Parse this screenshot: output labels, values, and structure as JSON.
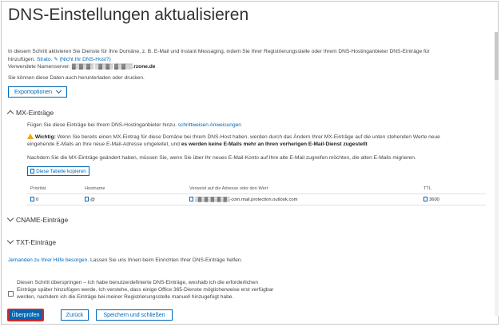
{
  "page": {
    "title": "DNS-Einstellungen aktualisieren"
  },
  "intro": {
    "line1": "In diesem Schritt aktivieren Sie Dienste für Ihre Domäne, z. B. E-Mail und Instant Messaging, indem Sie Ihrer Registrierungsstelle oder Ihrem DNS-Hostinganbieter DNS-Einträge für",
    "line1_tail": "hinzufügen.",
    "line2_prefix": "hinzufügen.",
    "provider": "Strato.",
    "not_host_link": "(Nicht Ihr DNS-Host?)",
    "nameserver_label": "Verwendete Namenserver:",
    "nameserver_value": "rzone.de",
    "download_text": "Sie können diese Daten auch herunterladen oder drucken."
  },
  "export": {
    "label": "Exportoptionen"
  },
  "mx": {
    "heading": "MX-Einträge",
    "instructions": "Fügen Sie diese Einträge bei Ihrem DNS-Hostinganbieter hinzu.",
    "instructions_link": "schrittweisen Anweisungen",
    "warning_label": "Wichtig:",
    "warning_text": "Wenn Sie bereits einen MX-Eintrag für diese Domäne bei Ihrem DNS-Host haben, werden durch das Ändern Ihrer MX-Einträge auf die unten stehenden Werte neue",
    "warning_line2": "eingehende E-Mails an Ihre neue E-Mail-Adresse umgeleitet, und",
    "warning_bold": "es werden keine E-Mails mehr an Ihren vorherigen E-Mail-Dienst zugestellt",
    "after_change": "Nachdem Sie die MX-Einträge geändert haben, müssen Sie, wenn Sie über Ihr neues E-Mail-Konto auf Ihre alte E-Mail zugreifen möchten, die alten E-Mails migrieren.",
    "copy_button": "Diese Tabelle kopieren",
    "columns": [
      "Priorität",
      "Hostname",
      "Verweist auf die Adresse oder den Wert",
      "TTL"
    ],
    "rows": [
      {
        "priority": "0",
        "hostname": "@",
        "value": "com.mail.protection.outlook.com",
        "ttl": "3600"
      }
    ]
  },
  "cname": {
    "heading": "CNAME-Einträge"
  },
  "txt": {
    "heading": "TXT-Einträge"
  },
  "help": {
    "link": "Jemanden zu Ihrer Hilfe besorgen.",
    "text": "Lassen Sie uns Ihnen beim Einrichten Ihrer DNS-Einträge helfen."
  },
  "skip": {
    "line1": "Diesen Schritt überspringen – Ich habe benutzerdefinierte DNS-Einträge, weshalb ich die erforderlichen",
    "line2": "Einträge später hinzufügen werde. Ich verstehe, dass einige Office 365-Dienste möglicherweise erst verfügbar",
    "line3": "werden, nachdem ich die Einträge bei meiner Registrierungsstelle manuell hinzugefügt habe."
  },
  "buttons": {
    "verify": "Überprüfen",
    "back": "Zurück",
    "save_close": "Speichern und schließen"
  },
  "colors": {
    "accent": "#0067b8",
    "warning": "#f2a900",
    "highlight": "#d62828"
  }
}
